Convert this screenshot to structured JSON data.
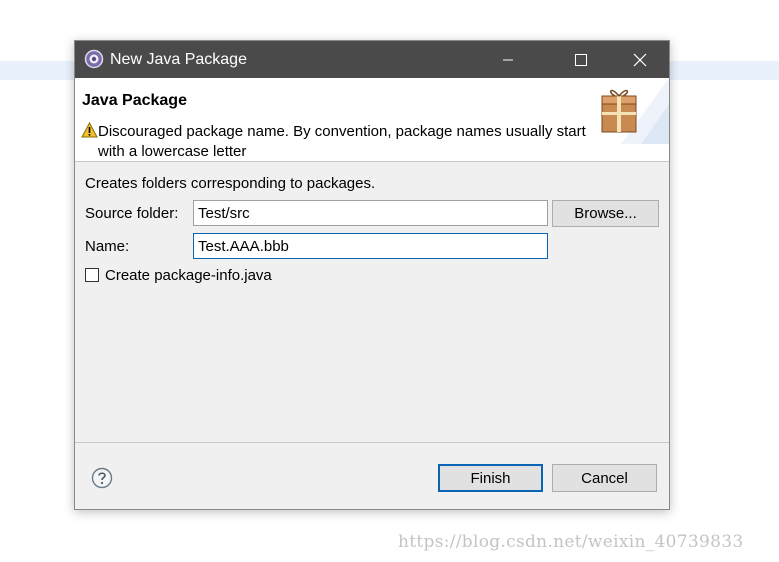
{
  "window": {
    "title": "New Java Package",
    "controls": [
      "minimize",
      "maximize",
      "close"
    ]
  },
  "header": {
    "title": "Java Package",
    "warning": "Discouraged package name. By convention, package names usually start with a lowercase letter"
  },
  "form": {
    "description": "Creates folders corresponding to packages.",
    "source_folder": {
      "label": "Source folder:",
      "value": "Test/src"
    },
    "browse_label": "Browse...",
    "name": {
      "label": "Name:",
      "value": "Test.AAA.bbb"
    },
    "create_package_info": {
      "label": "Create package-info.java",
      "checked": false
    }
  },
  "footer": {
    "finish_label": "Finish",
    "cancel_label": "Cancel"
  },
  "watermark": "https://blog.csdn.net/weixin_40739833",
  "colors": {
    "titlebar": "#4a4a4a",
    "accent": "#0a64b4",
    "dialog_bg": "#f0f0f0",
    "warning": "#f2c12e"
  }
}
